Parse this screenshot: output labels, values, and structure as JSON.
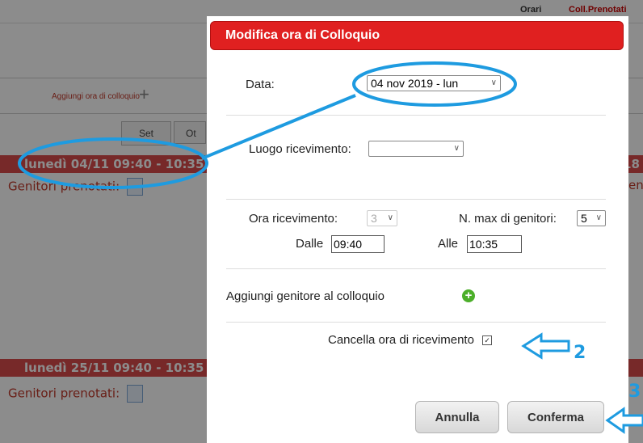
{
  "background": {
    "top_tabs": [
      "Orari",
      "Coll.Prenotati"
    ],
    "add_slot_label": "Aggiungi ora di colloquio",
    "day_headers": [
      "Set",
      "Ot"
    ],
    "slots": [
      {
        "header": "lunedì  04/11  09:40 - 10:35",
        "booked_label": "Genitori prenotati:",
        "right_text": "18"
      },
      {
        "header": "lunedì  25/11  09:40 - 10:35",
        "booked_label": "Genitori prenotati:"
      }
    ],
    "right_fragment": "en"
  },
  "dialog": {
    "title": "Modifica ora di Colloquio",
    "date_label": "Data:",
    "date_value": "04 nov 2019 - lun",
    "place_label": "Luogo ricevimento:",
    "place_value": "",
    "hour_label": "Ora ricevimento:",
    "hour_value": "3",
    "max_parents_label": "N. max di genitori:",
    "max_parents_value": "5",
    "from_label": "Dalle",
    "from_value": "09:40",
    "to_label": "Alle",
    "to_value": "10:35",
    "add_parent_label": "Aggiungi genitore al colloquio",
    "delete_label": "Cancella ora di ricevimento",
    "delete_checked": true,
    "cancel_label": "Annulla",
    "confirm_label": "Conferma"
  },
  "annotations": {
    "step2": "2",
    "step3": "3",
    "color": "#1e9be0"
  },
  "colors": {
    "dialog_title_bg": "#e02020",
    "slot_bar": "#d94b4b",
    "add_icon": "#4caf2a"
  }
}
